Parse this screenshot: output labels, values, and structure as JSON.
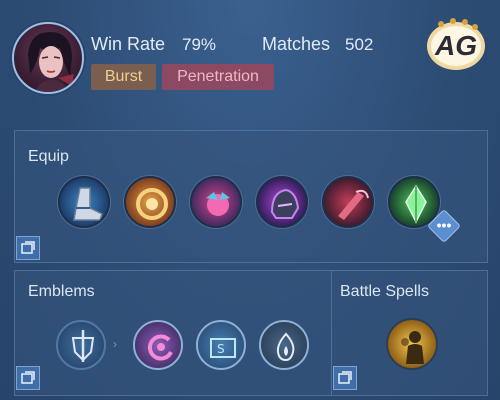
{
  "hero": {
    "win_rate_label": "Win Rate",
    "win_rate_value": "79%",
    "matches_label": "Matches",
    "matches_value": "502",
    "tags": [
      "Burst",
      "Penetration"
    ],
    "avatar_icon": "hero-portrait"
  },
  "brand": {
    "logo_text": "AG"
  },
  "equip": {
    "title": "Equip",
    "items": [
      {
        "icon": "boots-icon"
      },
      {
        "icon": "golden-ring-icon"
      },
      {
        "icon": "pink-orb-icon"
      },
      {
        "icon": "purple-helmet-icon"
      },
      {
        "icon": "crimson-scythe-icon"
      },
      {
        "icon": "green-crystal-icon"
      }
    ],
    "more_label": "•••"
  },
  "emblems": {
    "title": "Emblems",
    "items": [
      {
        "icon": "sword-shield-emblem-icon"
      },
      {
        "icon": "pink-spiral-talent-icon"
      },
      {
        "icon": "ticket-talent-icon"
      },
      {
        "icon": "flame-talent-icon"
      }
    ]
  },
  "spells": {
    "title": "Battle Spells",
    "items": [
      {
        "icon": "silhouette-spell-icon"
      }
    ]
  },
  "colors": {
    "burst_bg": "#7a5f50",
    "penetration_bg": "#8c4a62",
    "accent": "#3f6ea8"
  }
}
